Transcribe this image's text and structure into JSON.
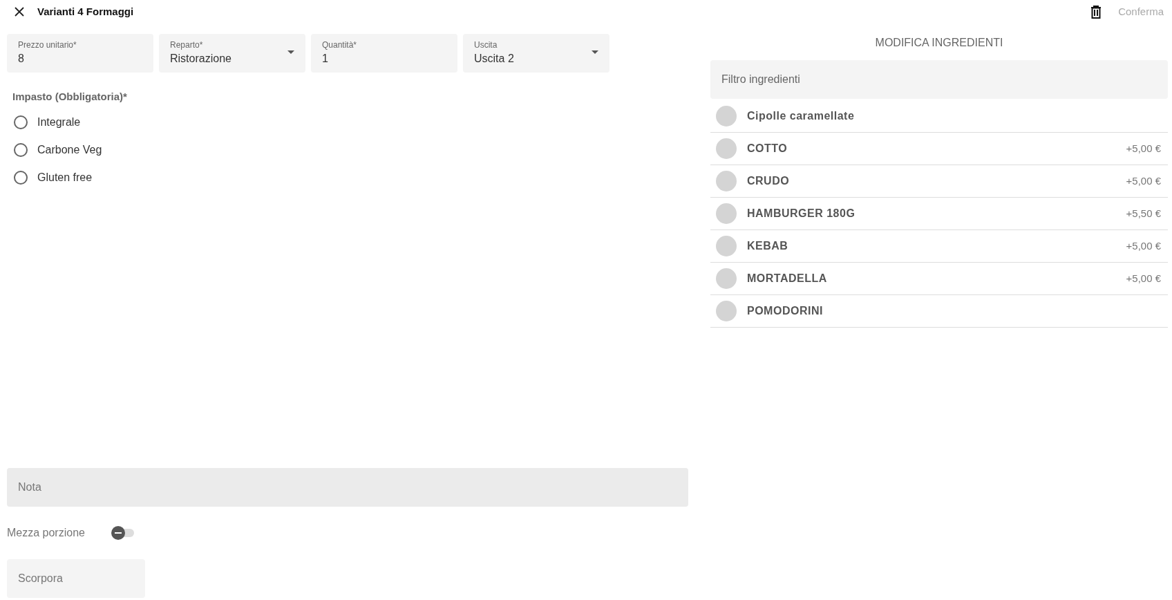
{
  "header": {
    "title": "Varianti 4 Formaggi",
    "confirm": "Conferma"
  },
  "fields": [
    {
      "kind": "text",
      "label": "Prezzo unitario*",
      "value": "8"
    },
    {
      "kind": "select",
      "label": "Reparto*",
      "value": "Ristorazione"
    },
    {
      "kind": "text",
      "label": "Quantità*",
      "value": "1"
    },
    {
      "kind": "select",
      "label": "Uscita",
      "value": "Uscita 2"
    }
  ],
  "impasto": {
    "label": "Impasto (Obbligatoria)*",
    "options": [
      {
        "label": "Integrale",
        "selected": false
      },
      {
        "label": "Carbone Veg",
        "selected": false
      },
      {
        "label": "Gluten free",
        "selected": false
      }
    ]
  },
  "note": {
    "placeholder": "Nota"
  },
  "half_portion": {
    "label": "Mezza porzione",
    "on": false
  },
  "scorpora": {
    "placeholder": "Scorpora"
  },
  "ingredients": {
    "title": "MODIFICA INGREDIENTI",
    "filter_placeholder": "Filtro ingredienti",
    "items": [
      {
        "name": "Cipolle caramellate",
        "checked": false
      },
      {
        "name": "COTTO",
        "price": "+5,00 €",
        "checked": false
      },
      {
        "name": "CRUDO",
        "price": "+5,00 €",
        "checked": false
      },
      {
        "name": "HAMBURGER 180G",
        "price": "+5,50 €",
        "checked": false
      },
      {
        "name": "KEBAB",
        "price": "+5,00 €",
        "checked": false
      },
      {
        "name": "MORTADELLA",
        "price": "+5,00 €",
        "checked": false
      },
      {
        "name": "POMODORINI",
        "checked": false
      }
    ]
  }
}
